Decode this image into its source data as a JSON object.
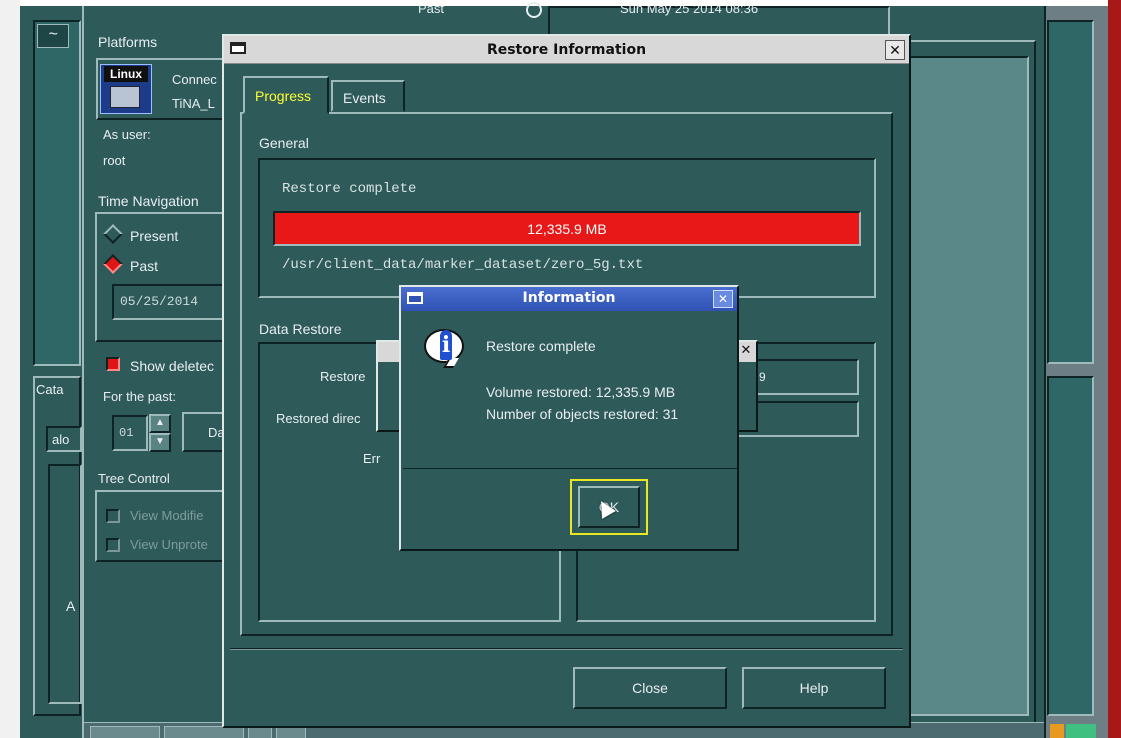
{
  "sidebar": {
    "platforms_label": "Platforms",
    "platform": {
      "os_badge": "Linux",
      "status": "Connec",
      "name": "TiNA_L",
      "as_user_label": "As user:",
      "user": "root"
    },
    "time_navigation": {
      "label": "Time Navigation",
      "present_label": "Present",
      "past_label": "Past",
      "selected": "Past",
      "date_value": "05/25/2014"
    },
    "show_deleted_label": "Show deletec",
    "for_past_label": "For the past:",
    "for_past_value": "01",
    "days_button_label": "Da",
    "tree_control": {
      "label": "Tree Control",
      "view_modified_label": "View Modifie",
      "view_unprot_label": "View Unprote"
    }
  },
  "left_strip": {
    "cata_tab": "Cata",
    "alo_field": "alo",
    "a_label": "A"
  },
  "top_bar": {
    "past_label": "Past",
    "date_text": "Sun May 25 2014 08:36"
  },
  "restore_dialog": {
    "title": "Restore Information",
    "close_glyph": "✕",
    "tabs": [
      {
        "label": "Progress",
        "active": true
      },
      {
        "label": "Events",
        "active": false
      }
    ],
    "general": {
      "label": "General",
      "status": "Restore complete",
      "progress_text": "12,335.9 MB",
      "progress_fraction": 1.0,
      "file_path": "/usr/client_data/marker_dataset/zero_5g.txt"
    },
    "data_restore": {
      "label": "Data Restore",
      "restored_label": "Restore",
      "restored_dir_label": "Restored direc",
      "errors_label": "Err",
      "field_1_value": "9"
    },
    "buttons": {
      "close": "Close",
      "help": "Help"
    }
  },
  "info_dialog": {
    "title": "Information",
    "close_glyph": "✕",
    "message": "Restore complete",
    "volume_restored": "Volume restored: 12,335.9 MB",
    "objects_restored": "Number of objects restored: 31",
    "ok_label": "OK",
    "icon": "info-icon"
  },
  "colors": {
    "panel": "#2e5a5a",
    "progress_bar": "#e81818",
    "active_tab_text": "#ffff33",
    "info_titlebar": "#2f52b4",
    "focus_ring": "#e8e820"
  }
}
